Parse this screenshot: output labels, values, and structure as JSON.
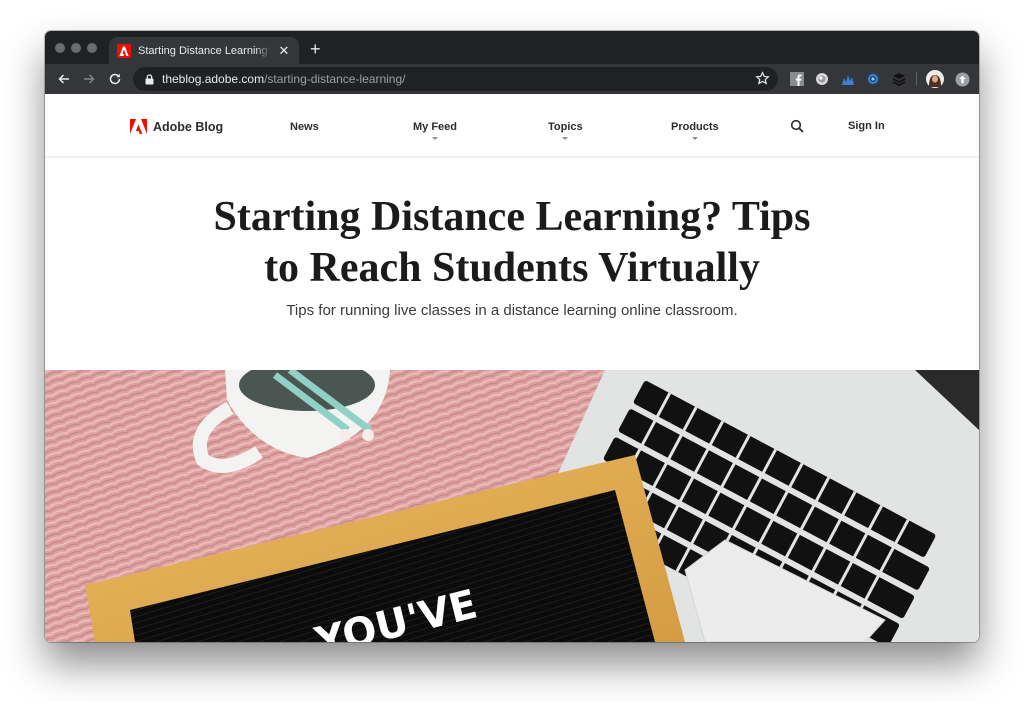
{
  "browser": {
    "tab": {
      "title": "Starting Distance Learning? Tips to Reach Students Virtually",
      "favicon": "adobe-logo-icon",
      "close_icon": "close-icon"
    },
    "new_tab_label": "+",
    "url": {
      "host": "theblog.adobe.com",
      "path": "/starting-distance-learning/"
    },
    "icons": {
      "back": "arrow-left-icon",
      "forward": "arrow-right-icon",
      "reload": "reload-icon",
      "lock": "lock-icon",
      "bookmark": "star-icon"
    },
    "extensions": [
      "facebook-icon",
      "circle-extension-icon",
      "blue-wave-extension-icon",
      "radar-extension-icon",
      "layers-extension-icon"
    ],
    "profile": "profile-avatar",
    "update": "update-icon"
  },
  "site": {
    "brand": "Adobe Blog",
    "brand_color": "#eb1000",
    "nav": [
      {
        "label": "News",
        "dropdown": false
      },
      {
        "label": "My Feed",
        "dropdown": true
      },
      {
        "label": "Topics",
        "dropdown": true
      },
      {
        "label": "Products",
        "dropdown": true
      }
    ],
    "search_icon": "search-icon",
    "sign_in": "Sign In"
  },
  "article": {
    "title_line1": "Starting Distance Learning? Tips",
    "title_line2": "to Reach Students Virtually",
    "subtitle": "Tips for running live classes in a distance learning online classroom.",
    "hero_image": {
      "description": "Pink fluffy rug with white mug holding pencils, letter board with wooden frame, and a laptop keyboard",
      "letterboard_text": "YOU'VE"
    }
  }
}
